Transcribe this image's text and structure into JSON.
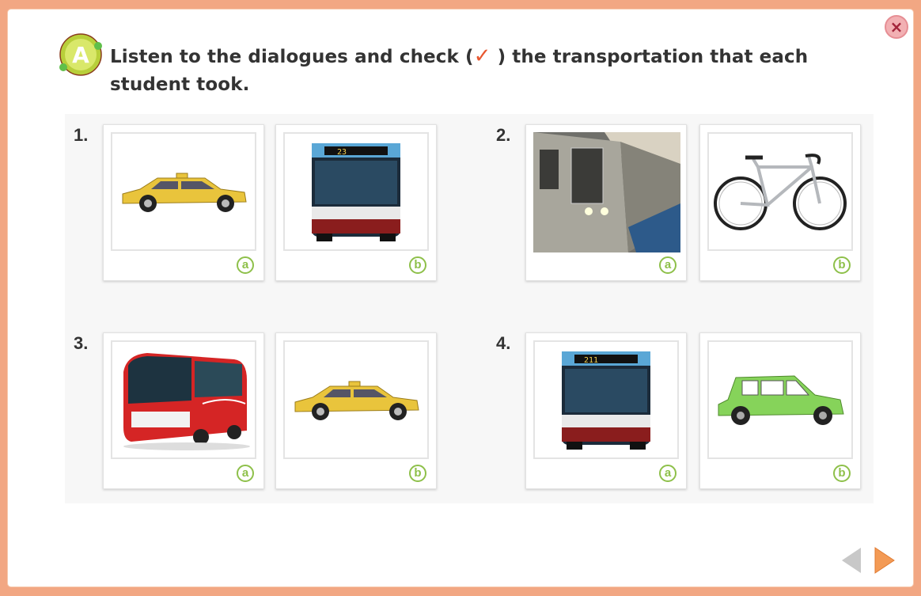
{
  "header": {
    "badge_letter": "A",
    "instruction_part1": "Listen to the dialogues and check (",
    "check_mark": "✓",
    "instruction_part2": " ) the transportation that each student took."
  },
  "close_symbol": "×",
  "questions": [
    {
      "number": "1.",
      "options": [
        {
          "label": "a",
          "image": "taxi-image"
        },
        {
          "label": "b",
          "image": "city-bus-image"
        }
      ]
    },
    {
      "number": "2.",
      "options": [
        {
          "label": "a",
          "image": "subway-train-image"
        },
        {
          "label": "b",
          "image": "bicycle-image"
        }
      ]
    },
    {
      "number": "3.",
      "options": [
        {
          "label": "a",
          "image": "coach-bus-image"
        },
        {
          "label": "b",
          "image": "taxi-image"
        }
      ]
    },
    {
      "number": "4.",
      "options": [
        {
          "label": "a",
          "image": "city-bus-image"
        },
        {
          "label": "b",
          "image": "car-image"
        }
      ]
    }
  ],
  "bus_route_numbers": [
    "23",
    "211"
  ],
  "colors": {
    "accent": "#8ec04a",
    "border": "#f2a783",
    "next": "#f39a55",
    "prev": "#c8c8c8"
  }
}
